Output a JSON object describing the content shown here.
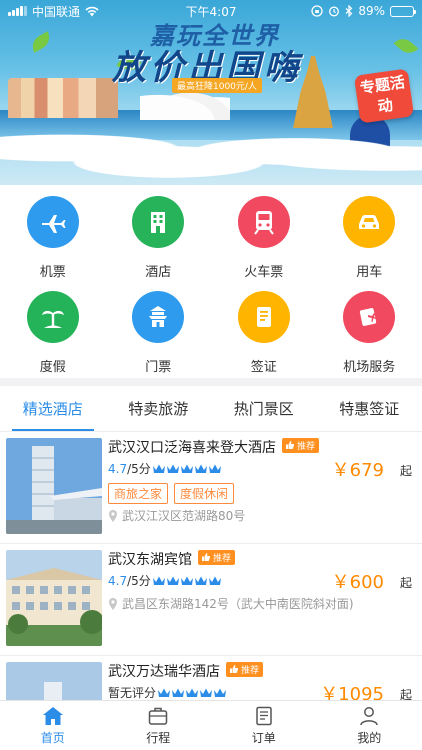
{
  "status_bar": {
    "carrier": "中国联通",
    "time": "下午4:07",
    "battery": "89%",
    "battery_level": 0.89
  },
  "banner": {
    "headline_small": "嘉玩全世界",
    "headline_large": "放价出国嗨",
    "subtitle": "最高狂降1000元/人",
    "promo_badge": "专题活动"
  },
  "services": [
    {
      "label": "机票",
      "icon": "plane-icon",
      "color": "#2f9bef"
    },
    {
      "label": "酒店",
      "icon": "hotel-building-icon",
      "color": "#27b35a"
    },
    {
      "label": "火车票",
      "icon": "train-icon",
      "color": "#f1495f"
    },
    {
      "label": "用车",
      "icon": "car-icon",
      "color": "#ffb400"
    },
    {
      "label": "度假",
      "icon": "palm-tree-icon",
      "color": "#25b35a"
    },
    {
      "label": "门票",
      "icon": "temple-ticket-icon",
      "color": "#2f9bef"
    },
    {
      "label": "签证",
      "icon": "visa-document-icon",
      "color": "#ffb400"
    },
    {
      "label": "机场服务",
      "icon": "airport-service-icon",
      "color": "#f1495f"
    }
  ],
  "tabs": [
    {
      "label": "精选酒店",
      "active": true
    },
    {
      "label": "特卖旅游",
      "active": false
    },
    {
      "label": "热门景区",
      "active": false
    },
    {
      "label": "特惠签证",
      "active": false
    }
  ],
  "recommend_badge": "推荐",
  "price_suffix": "起",
  "hotels": [
    {
      "name": "武汉汉口泛海喜来登大酒店",
      "score": "4.7",
      "score_suffix": "/5分",
      "crowns": 5,
      "price": "￥679",
      "tags": [
        "商旅之家",
        "度假休闲"
      ],
      "address": "武汉江汉区范湖路80号"
    },
    {
      "name": "武汉东湖宾馆",
      "score": "4.7",
      "score_suffix": "/5分",
      "crowns": 5,
      "price": "￥600",
      "tags": [],
      "address": "武昌区东湖路142号（武大中南医院斜对面)"
    },
    {
      "name": "武汉万达瑞华酒店",
      "score": "暂无评分",
      "score_suffix": "",
      "crowns": 5,
      "price": "￥1095",
      "tags": [],
      "address": ""
    }
  ],
  "bottom_nav": [
    {
      "label": "首页",
      "icon": "home-icon",
      "active": true
    },
    {
      "label": "行程",
      "icon": "suitcase-icon",
      "active": false
    },
    {
      "label": "订单",
      "icon": "order-list-icon",
      "active": false
    },
    {
      "label": "我的",
      "icon": "user-icon",
      "active": false
    }
  ]
}
